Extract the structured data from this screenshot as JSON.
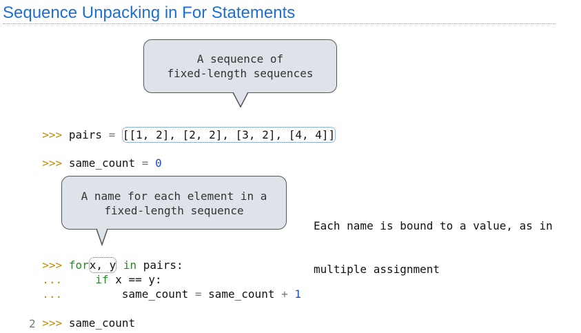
{
  "slide": {
    "title": "Sequence Unpacking in For Statements"
  },
  "callouts": {
    "top": {
      "line1": "A sequence of",
      "line2": "fixed-length sequences"
    },
    "middle": {
      "line1": "A name for each element in a",
      "line2": "fixed-length sequence"
    }
  },
  "note": {
    "line1": "Each name is bound to a value, as in",
    "line2": "multiple assignment"
  },
  "code": {
    "prompt": ">>>",
    "continuation": "...",
    "pairs_name": "pairs",
    "assign_op": "=",
    "pairs_value": "[[1, 2], [2, 2], [3, 2], [4, 4]]",
    "count_name": "same_count",
    "zero": "0",
    "for_kw": "for",
    "loop_vars": "x, y",
    "in_kw": "in",
    "iter": "pairs:",
    "if_kw": "if",
    "cond": "x == y:",
    "update_lhs": "same_count",
    "update_rhs": "same_count",
    "plus": "+",
    "one": "1",
    "final_expr": "same_count",
    "result": "2"
  }
}
